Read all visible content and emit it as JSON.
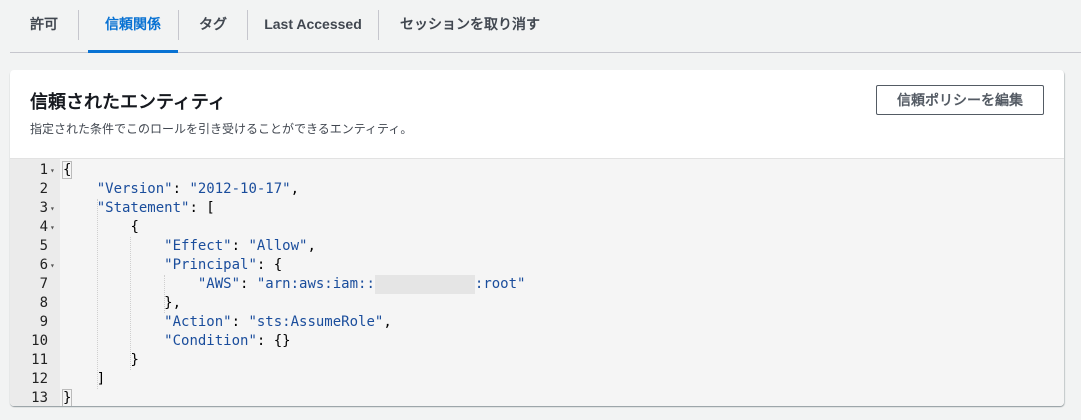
{
  "tabs": [
    {
      "label": "許可",
      "active": false
    },
    {
      "label": "信頼関係",
      "active": true
    },
    {
      "label": "タグ",
      "active": false
    },
    {
      "label": "Last Accessed",
      "active": false
    },
    {
      "label": "セッションを取り消す",
      "active": false
    }
  ],
  "panel": {
    "title": "信頼されたエンティティ",
    "description": "指定された条件でこのロールを引き受けることができるエンティティ。",
    "edit_button_label": "信頼ポリシーを編集"
  },
  "editor": {
    "line_numbers": [
      "1",
      "2",
      "3",
      "4",
      "5",
      "6",
      "7",
      "8",
      "9",
      "10",
      "11",
      "12",
      "13"
    ],
    "fold_markers": [
      "▾",
      "",
      "▾",
      "▾",
      "",
      "▾",
      "",
      "",
      "",
      "",
      "",
      "",
      ""
    ],
    "lines": [
      {
        "indent": "",
        "key": "",
        "sep": "",
        "value": "",
        "tail": "{"
      },
      {
        "indent": "    ",
        "key": "\"Version\"",
        "sep": ": ",
        "value": "\"2012-10-17\"",
        "tail": ","
      },
      {
        "indent": "    ",
        "key": "\"Statement\"",
        "sep": ": ",
        "value": "",
        "tail": "["
      },
      {
        "indent": "        ",
        "key": "",
        "sep": "",
        "value": "",
        "tail": "{"
      },
      {
        "indent": "            ",
        "key": "\"Effect\"",
        "sep": ": ",
        "value": "\"Allow\"",
        "tail": ","
      },
      {
        "indent": "            ",
        "key": "\"Principal\"",
        "sep": ": ",
        "value": "",
        "tail": "{"
      },
      {
        "indent": "                ",
        "key": "\"AWS\"",
        "sep": ": ",
        "value": "\"arn:aws:iam::",
        "value_after_mask": ":root\"",
        "tail": ""
      },
      {
        "indent": "            ",
        "key": "",
        "sep": "",
        "value": "",
        "tail": "},"
      },
      {
        "indent": "            ",
        "key": "\"Action\"",
        "sep": ": ",
        "value": "\"sts:AssumeRole\"",
        "tail": ","
      },
      {
        "indent": "            ",
        "key": "\"Condition\"",
        "sep": ": ",
        "value": "",
        "tail": "{}"
      },
      {
        "indent": "        ",
        "key": "",
        "sep": "",
        "value": "",
        "tail": "}"
      },
      {
        "indent": "    ",
        "key": "",
        "sep": "",
        "value": "",
        "tail": "]"
      },
      {
        "indent": "",
        "key": "",
        "sep": "",
        "value": "",
        "tail": "}"
      }
    ]
  }
}
